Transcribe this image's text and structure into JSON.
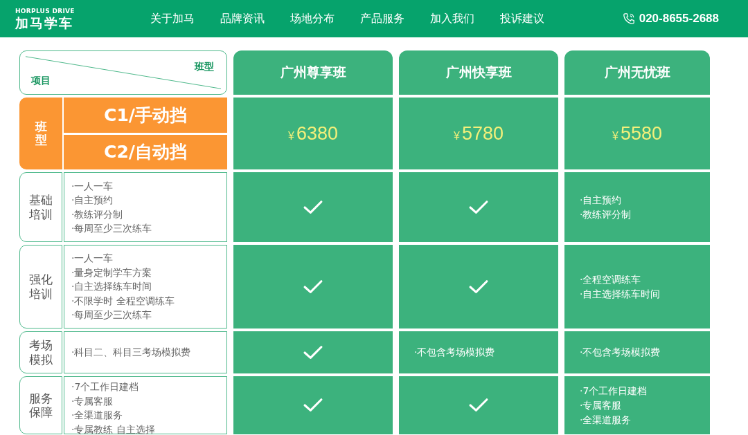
{
  "header": {
    "logo": {
      "subtitle": "HORPLUS DRIVE",
      "title": "加马学车"
    },
    "nav": [
      {
        "label": "关于加马"
      },
      {
        "label": "品牌资讯"
      },
      {
        "label": "场地分布"
      },
      {
        "label": "产品服务"
      },
      {
        "label": "加入我们"
      },
      {
        "label": "投诉建议"
      }
    ],
    "phone": "020-8655-2688"
  },
  "table": {
    "corner": {
      "column_label": "班型",
      "row_label": "项目"
    },
    "plans": [
      {
        "name": "广州尊享班",
        "currency": "¥",
        "price": "6380"
      },
      {
        "name": "广州快享班",
        "currency": "¥",
        "price": "5780"
      },
      {
        "name": "广州无忧班",
        "currency": "¥",
        "price": "5580"
      }
    ],
    "class_type": {
      "label": "班型",
      "options": [
        "C1/手动挡",
        "C2/自动挡"
      ]
    },
    "rows": [
      {
        "label": "基础培训",
        "items": [
          "·一人一车",
          "·自主预约",
          "·教练评分制",
          "·每周至少三次练车"
        ],
        "cells": [
          {
            "kind": "check"
          },
          {
            "kind": "check"
          },
          {
            "kind": "text",
            "lines": [
              "·自主预约",
              "·教练评分制"
            ]
          }
        ]
      },
      {
        "label": "强化培训",
        "items": [
          "·一人一车",
          "·量身定制学车方案",
          "·自主选择练车时间",
          "·不限学时 全程空调练车",
          "·每周至少三次练车"
        ],
        "cells": [
          {
            "kind": "check"
          },
          {
            "kind": "check"
          },
          {
            "kind": "text",
            "lines": [
              "·全程空调练车",
              "·自主选择练车时间"
            ]
          }
        ]
      },
      {
        "label": "考场模拟",
        "items": [
          "·科目二、科目三考场模拟费"
        ],
        "cells": [
          {
            "kind": "check"
          },
          {
            "kind": "text",
            "lines": [
              "·不包含考场模拟费"
            ]
          },
          {
            "kind": "text",
            "lines": [
              "·不包含考场模拟费"
            ]
          }
        ]
      },
      {
        "label": "服务保障",
        "items": [
          "·7个工作日建档",
          "·专属客服",
          "·全渠道服务",
          "·专属教练 自主选择"
        ],
        "cells": [
          {
            "kind": "check"
          },
          {
            "kind": "check"
          },
          {
            "kind": "text",
            "lines": [
              "·7个工作日建档",
              "·专属客服",
              "·全渠道服务"
            ]
          }
        ]
      }
    ]
  }
}
